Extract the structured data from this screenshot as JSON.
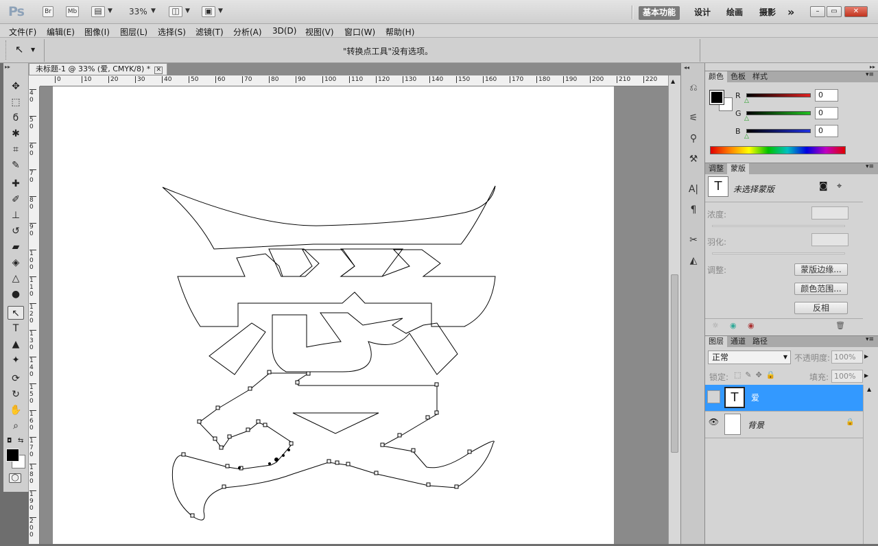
{
  "appbar": {
    "logo": "Ps",
    "br": "Br",
    "mb": "Mb",
    "zoom": "33%",
    "workspaces": [
      "基本功能",
      "设计",
      "绘画",
      "摄影"
    ],
    "more": "»",
    "window_controls": [
      "–",
      "▭",
      "✕"
    ]
  },
  "menubar": {
    "items": [
      "文件(F)",
      "编辑(E)",
      "图像(I)",
      "图层(L)",
      "选择(S)",
      "滤镜(T)",
      "分析(A)",
      "3D(D)",
      "视图(V)",
      "窗口(W)",
      "帮助(H)"
    ]
  },
  "options": {
    "message": "\"转换点工具\"没有选项。"
  },
  "document": {
    "tab_title": "未标题-1 @ 33% (爱, CMYK/8) *",
    "close": "✕",
    "hruler": [
      "0",
      "10",
      "20",
      "30",
      "40",
      "50",
      "60",
      "70",
      "80",
      "90",
      "100",
      "110",
      "120",
      "130",
      "140",
      "150",
      "160",
      "170",
      "180",
      "190",
      "200",
      "210",
      "220"
    ],
    "vruler": [
      "40",
      "50",
      "60",
      "70",
      "80",
      "90",
      "100",
      "110",
      "120",
      "130",
      "140",
      "150",
      "160",
      "170",
      "180",
      "190",
      "200"
    ]
  },
  "color_panel": {
    "tabs": [
      "颜色",
      "色板",
      "样式"
    ],
    "channels": [
      {
        "label": "R",
        "value": "0",
        "color": "#e02020"
      },
      {
        "label": "G",
        "value": "0",
        "color": "#20c020"
      },
      {
        "label": "B",
        "value": "0",
        "color": "#2030e0"
      }
    ]
  },
  "masks_panel": {
    "tabs": [
      "调整",
      "蒙版"
    ],
    "status": "未选择蒙版",
    "density_label": "浓度:",
    "feather_label": "羽化:",
    "refine_label": "调整:",
    "buttons": [
      "蒙版边缘...",
      "颜色范围...",
      "反相"
    ]
  },
  "layers_panel": {
    "tabs": [
      "图层",
      "通道",
      "路径"
    ],
    "blend_mode": "正常",
    "opacity_label": "不透明度:",
    "opacity": "100%",
    "lock_label": "锁定:",
    "fill_label": "填充:",
    "fill": "100%",
    "layers": [
      {
        "name": "爱",
        "thumb": "T",
        "selected": true,
        "visible": false
      },
      {
        "name": "背景",
        "thumb": "",
        "selected": false,
        "visible": true
      }
    ]
  }
}
